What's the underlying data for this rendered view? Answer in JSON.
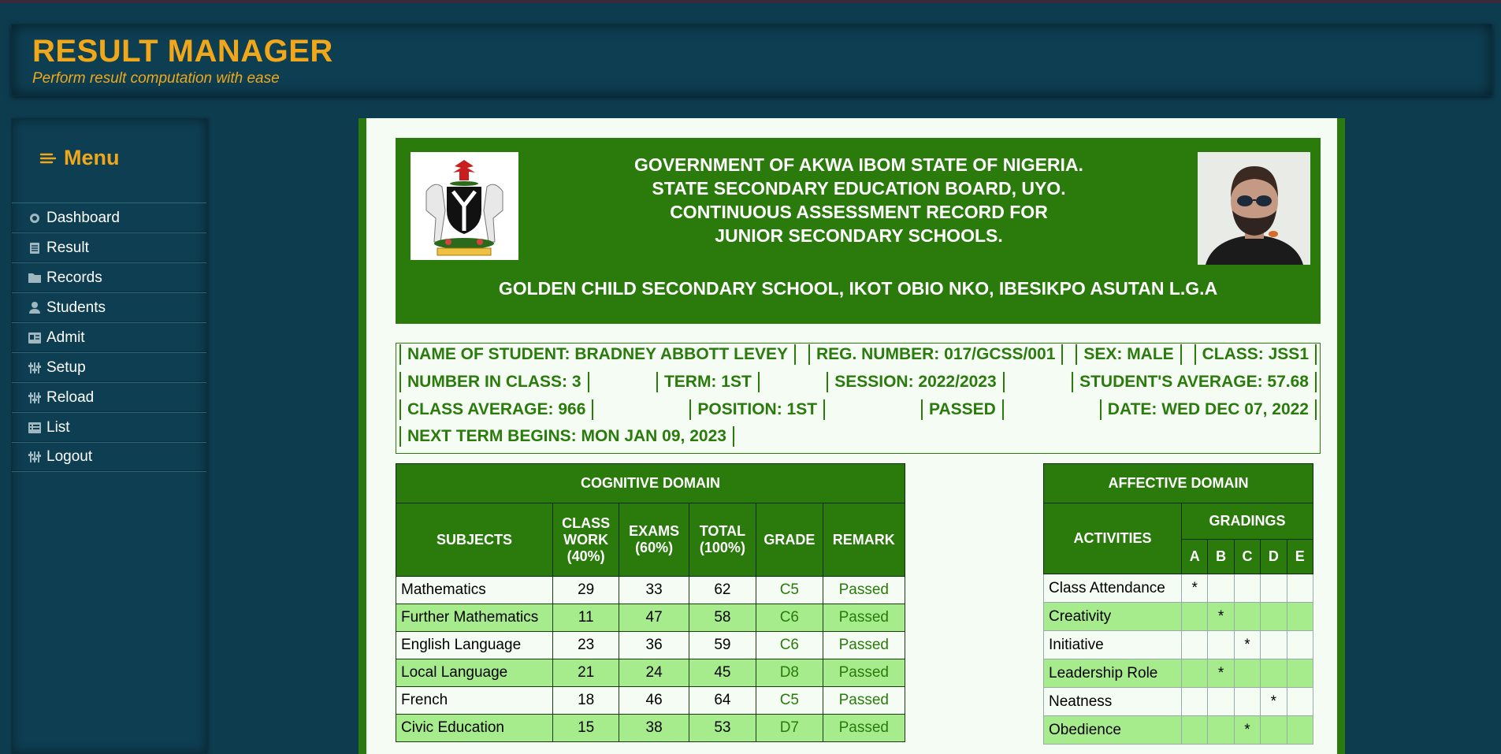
{
  "header": {
    "title": "RESULT MANAGER",
    "tagline": "Perform result computation with ease"
  },
  "sidebar": {
    "title": "Menu",
    "items": [
      {
        "label": "Dashboard",
        "icon": "dashboard-icon"
      },
      {
        "label": "Result",
        "icon": "document-icon"
      },
      {
        "label": "Records",
        "icon": "folder-icon"
      },
      {
        "label": "Students",
        "icon": "student-icon"
      },
      {
        "label": "Admit",
        "icon": "admit-icon"
      },
      {
        "label": "Setup",
        "icon": "sliders-icon"
      },
      {
        "label": "Reload",
        "icon": "sliders-icon"
      },
      {
        "label": "List",
        "icon": "list-icon"
      },
      {
        "label": "Logout",
        "icon": "sliders-icon"
      }
    ]
  },
  "banner": {
    "line1": "GOVERNMENT OF AKWA IBOM STATE OF NIGERIA.",
    "line2": "STATE SECONDARY EDUCATION BOARD, UYO.",
    "line3": "CONTINUOUS ASSESSMENT RECORD FOR",
    "line4": "JUNIOR SECONDARY SCHOOLS.",
    "school": "GOLDEN CHILD SECONDARY SCHOOL, IKOT OBIO NKO, IBESIKPO ASUTAN L.G.A",
    "coat_of_arms_text": "UNITY AND FAITH, PEACE AND PROGRESS"
  },
  "student_info": {
    "name": "NAME OF STUDENT: BRADNEY ABBOTT LEVEY",
    "reg": "REG. NUMBER: 017/GCSS/001",
    "sex": "SEX: MALE",
    "class": "CLASS: JSS1",
    "number_in_class": "NUMBER IN CLASS: 3",
    "term": "TERM: 1ST",
    "session": "SESSION: 2022/2023",
    "student_average": "STUDENT'S AVERAGE: 57.68",
    "class_average": "CLASS AVERAGE: 966",
    "position": "POSITION: 1ST",
    "status": "PASSED",
    "date": "DATE: WED DEC 07, 2022",
    "next_term": "NEXT TERM BEGINS: MON JAN 09, 2023"
  },
  "cognitive": {
    "title": "COGNITIVE DOMAIN",
    "headers": {
      "subjects": "SUBJECTS",
      "classwork_1": "CLASS",
      "classwork_2": "WORK",
      "classwork_3": "(40%)",
      "exams_1": "EXAMS",
      "exams_2": "(60%)",
      "total_1": "TOTAL",
      "total_2": "(100%)",
      "grade": "GRADE",
      "remark": "REMARK"
    },
    "rows": [
      {
        "subject": "Mathematics",
        "classwork": "29",
        "exams": "33",
        "total": "62",
        "grade": "C5",
        "remark": "Passed"
      },
      {
        "subject": "Further Mathematics",
        "classwork": "11",
        "exams": "47",
        "total": "58",
        "grade": "C6",
        "remark": "Passed"
      },
      {
        "subject": "English Language",
        "classwork": "23",
        "exams": "36",
        "total": "59",
        "grade": "C6",
        "remark": "Passed"
      },
      {
        "subject": "Local Language",
        "classwork": "21",
        "exams": "24",
        "total": "45",
        "grade": "D8",
        "remark": "Passed"
      },
      {
        "subject": "French",
        "classwork": "18",
        "exams": "46",
        "total": "64",
        "grade": "C5",
        "remark": "Passed"
      },
      {
        "subject": "Civic Education",
        "classwork": "15",
        "exams": "38",
        "total": "53",
        "grade": "D7",
        "remark": "Passed"
      }
    ]
  },
  "affective": {
    "title": "AFFECTIVE DOMAIN",
    "activities_label": "ACTIVITIES",
    "gradings_label": "GRADINGS",
    "grades": [
      "A",
      "B",
      "C",
      "D",
      "E"
    ],
    "rows": [
      {
        "activity": "Class Attendance",
        "marks": [
          "*",
          "",
          "",
          "",
          ""
        ]
      },
      {
        "activity": "Creativity",
        "marks": [
          "",
          "*",
          "",
          "",
          ""
        ]
      },
      {
        "activity": "Initiative",
        "marks": [
          "",
          "",
          "*",
          "",
          ""
        ]
      },
      {
        "activity": "Leadership Role",
        "marks": [
          "",
          "*",
          "",
          "",
          ""
        ]
      },
      {
        "activity": "Neatness",
        "marks": [
          "",
          "",
          "",
          "*",
          ""
        ]
      },
      {
        "activity": "Obedience",
        "marks": [
          "",
          "",
          "*",
          "",
          ""
        ]
      }
    ]
  },
  "colors": {
    "accent": "#f0a81a",
    "bg": "#0d3c4f",
    "green": "#2a7a0c",
    "row_alt": "#a6ec8c"
  }
}
